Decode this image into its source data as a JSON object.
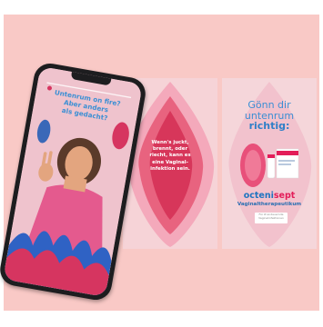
{
  "phone_story": {
    "headline_lines": [
      "Untenrum on fire?",
      "Aber anders",
      "als gedacht?"
    ]
  },
  "middle_story": {
    "text_lines": [
      "Wenn's juckt,",
      "brennt, oder",
      "riecht, kann es",
      "eine Vaginal-",
      "infektion sein."
    ]
  },
  "right_story": {
    "headline_lines": [
      "Gönn dir",
      "untenrum",
      "richtig:"
    ],
    "brand_a": "octeni",
    "brand_b": "sept",
    "brand_sub": "Vaginaltherapeutikum",
    "badge_lines": [
      "Für Ø andauernde",
      "Vaginalinfektionen"
    ]
  },
  "colors": {
    "background": "#f9c9c6",
    "accent_pink": "#e31d59",
    "accent_blue": "#1e74c0"
  }
}
